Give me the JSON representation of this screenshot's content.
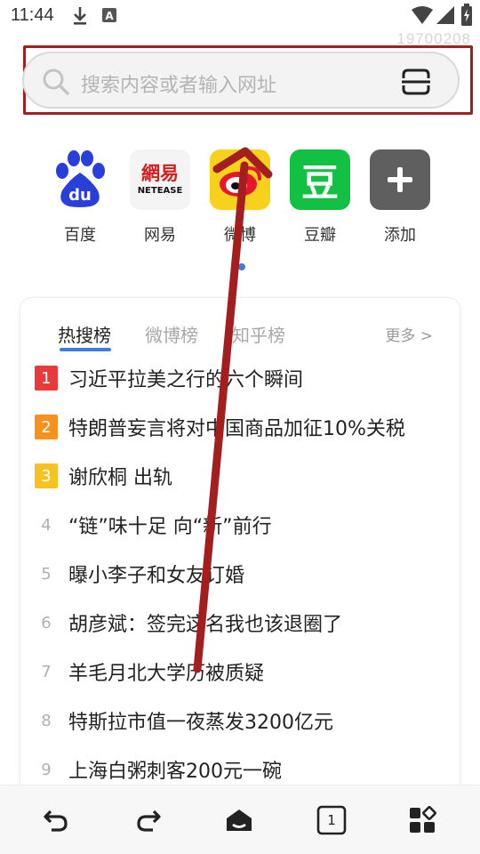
{
  "status_bar": {
    "time": "11:44",
    "watermark": "19700208",
    "icons": [
      "download-icon",
      "font-a-icon",
      "wifi-icon",
      "signal-icon",
      "battery-charging-icon"
    ]
  },
  "search": {
    "placeholder": "搜索内容或者输入网址",
    "scan_icon": "scan-icon",
    "highlight_color": "#a31f1f"
  },
  "quick_links": [
    {
      "label": "百度",
      "icon": "baidu-logo"
    },
    {
      "label": "网易",
      "icon": "netease-logo",
      "logo_text": "網易",
      "logo_sub": "NETEASE"
    },
    {
      "label": "微博",
      "icon": "weibo-logo"
    },
    {
      "label": "豆瓣",
      "icon": "douban-logo",
      "logo_text": "豆"
    },
    {
      "label": "添加",
      "icon": "add-icon"
    }
  ],
  "hot": {
    "tabs": [
      "热搜榜",
      "微博榜",
      "知乎榜"
    ],
    "active_tab": 0,
    "more": "更多 >",
    "items": [
      {
        "rank": "1",
        "text": "习近平拉美之行的六个瞬间",
        "color": "#e83a3a"
      },
      {
        "rank": "2",
        "text": "特朗普妄言将对中国商品加征10%关税",
        "color": "#f5921f"
      },
      {
        "rank": "3",
        "text": "谢欣桐 出轨",
        "color": "#f5c21f"
      },
      {
        "rank": "4",
        "text": "“链”味十足 向“新”前行"
      },
      {
        "rank": "5",
        "text": "曝小李子和女友订婚"
      },
      {
        "rank": "6",
        "text": "胡彦斌：签完这名我也该退圈了"
      },
      {
        "rank": "7",
        "text": "羊毛月北大学历被质疑"
      },
      {
        "rank": "8",
        "text": "特斯拉市值一夜蒸发3200亿元"
      },
      {
        "rank": "9",
        "text": "上海白粥刺客200元一碗"
      }
    ]
  },
  "bottom_nav": {
    "tab_count": "1",
    "icons": [
      "back-icon",
      "forward-icon",
      "home-icon",
      "tabs-icon",
      "apps-icon"
    ]
  },
  "colors": {
    "accent": "#3c7ddd",
    "annotation": "#a31f1f"
  }
}
